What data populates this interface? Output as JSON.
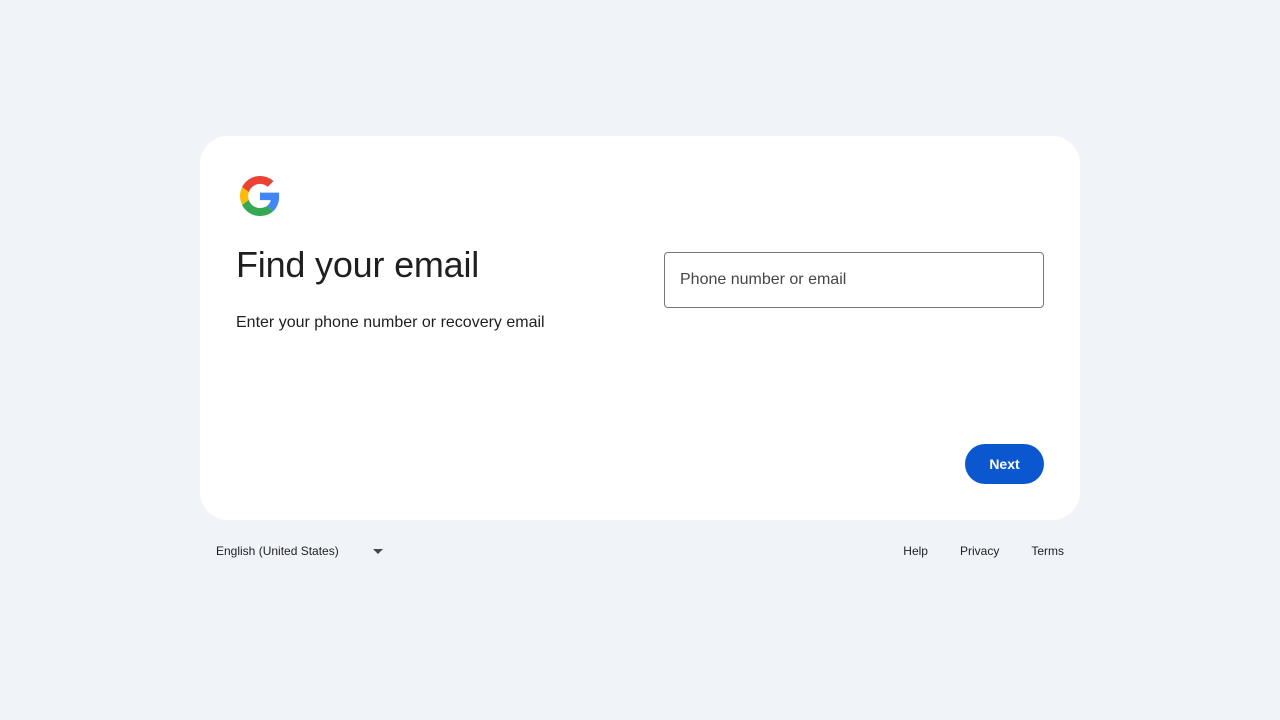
{
  "card": {
    "title": "Find your email",
    "subtitle": "Enter your phone number or recovery email",
    "input": {
      "placeholder": "Phone number or email",
      "value": ""
    },
    "next_label": "Next"
  },
  "footer": {
    "language": "English (United States)",
    "links": [
      "Help",
      "Privacy",
      "Terms"
    ]
  },
  "colors": {
    "background": "#f0f4f9",
    "card": "#ffffff",
    "primary": "#0b57d0",
    "text": "#1f1f1f",
    "input_border": "#747775"
  },
  "icons": {
    "logo": "google-g-logo",
    "language_dropdown": "caret-down-icon"
  }
}
